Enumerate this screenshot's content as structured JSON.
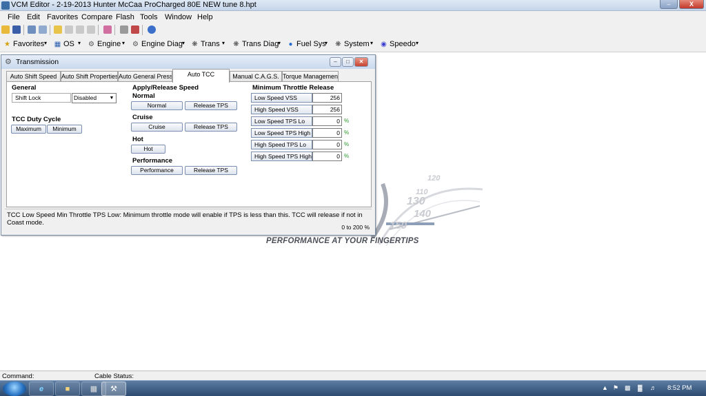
{
  "window": {
    "title": "VCM Editor - 2-19-2013 Hunter McCaa ProCharged 80E NEW tune 8.hpt",
    "min_glyph": "–",
    "max_glyph": "□",
    "close_glyph": "X"
  },
  "menu": [
    "File",
    "Edit",
    "Favorites",
    "Compare",
    "Flash",
    "Tools",
    "Window",
    "Help"
  ],
  "toolbar2": {
    "favorites": "Favorites",
    "os": "OS",
    "engine": "Engine",
    "engine_diag": "Engine Diag",
    "trans": "Trans",
    "trans_diag": "Trans Diag",
    "fuel_sys": "Fuel Sys",
    "system": "System",
    "speedo": "Speedo",
    "dropdown_glyph": "▾"
  },
  "child": {
    "title": "Transmission",
    "min_glyph": "–",
    "max_glyph": "□",
    "close_glyph": "✕",
    "tabs": [
      "Auto Shift Speed",
      "Auto Shift Properties",
      "Auto General Pressure",
      "Auto TCC",
      "Manual C.A.G.S.",
      "Torque Management"
    ],
    "active_tab": "Auto TCC",
    "general": {
      "header": "General",
      "shift_lock_label": "Shift Lock",
      "shift_lock_value": "Disabled",
      "arrow_glyph": "▼"
    },
    "tcc_duty": {
      "header": "TCC Duty Cycle",
      "maximum": "Maximum",
      "minimum": "Minimum"
    },
    "apply_release": {
      "header": "Apply/Release Speed",
      "normal_header": "Normal",
      "normal_btn": "Normal",
      "normal_release": "Release TPS",
      "cruise_header": "Cruise",
      "cruise_btn": "Cruise",
      "cruise_release": "Release TPS",
      "hot_header": "Hot",
      "hot_btn": "Hot",
      "performance_header": "Performance",
      "performance_btn": "Performance",
      "performance_release": "Release TPS"
    },
    "min_throttle": {
      "header": "Minimum Throttle Release",
      "pct_glyph": "%",
      "rows": [
        {
          "label": "Low Speed VSS",
          "value": "256"
        },
        {
          "label": "High Speed VSS",
          "value": "256"
        },
        {
          "label": "Low Speed TPS Lo",
          "value": "0"
        },
        {
          "label": "Low Speed TPS High",
          "value": "0"
        },
        {
          "label": "High Speed TPS Lo",
          "value": "0"
        },
        {
          "label": "High Speed TPS High",
          "value": "0"
        }
      ]
    },
    "help_text": "TCC Low Speed Min Throttle TPS Low: Minimum throttle mode will enable if TPS is less than this. TCC will release if not in Coast mode.",
    "range": "0 to 200 %"
  },
  "logo": {
    "tagline": "PERFORMANCE AT YOUR FINGERTIPS",
    "gauge_numbers": [
      "110",
      "120",
      "130",
      "140",
      "150"
    ]
  },
  "status": {
    "command_label": "Command:",
    "cable_label": "Cable Status:"
  },
  "taskbar": {
    "ie_glyph": "e",
    "clock": "8:52 PM"
  },
  "colors": {
    "accent": "#3a6ea5",
    "percent_green": "#2a9a2a"
  }
}
